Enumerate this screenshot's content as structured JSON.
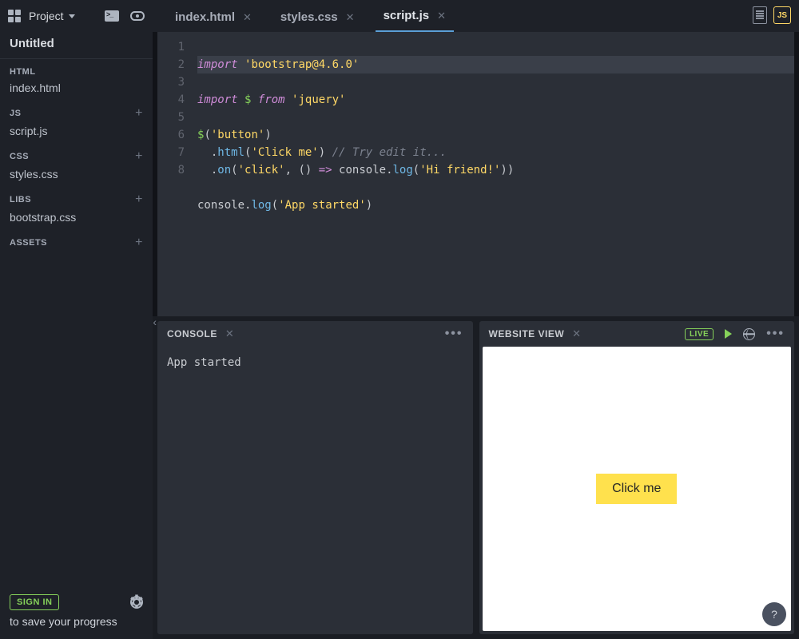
{
  "topbar": {
    "project_label": "Project"
  },
  "project": {
    "title": "Untitled"
  },
  "sections": {
    "html": {
      "heading": "HTML",
      "file": "index.html"
    },
    "js": {
      "heading": "JS",
      "file": "script.js"
    },
    "css": {
      "heading": "CSS",
      "file": "styles.css"
    },
    "libs": {
      "heading": "LIBS",
      "file": "bootstrap.css"
    },
    "assets": {
      "heading": "ASSETS"
    }
  },
  "signin": {
    "button": "SIGN IN",
    "caption": "to save your progress"
  },
  "tabs": {
    "t0": {
      "label": "index.html"
    },
    "t1": {
      "label": "styles.css"
    },
    "t2": {
      "label": "script.js"
    },
    "ext_badge": "JS"
  },
  "code": {
    "line1": {
      "kw": "import",
      "str": "'bootstrap@4.6.0'"
    },
    "line2": {
      "kw": "import",
      "var": "$",
      "from": "from",
      "str": "'jquery'"
    },
    "line4": {
      "dollar": "$",
      "op": "(",
      "str": "'button'",
      "cp": ")"
    },
    "line5": {
      "dot": ".",
      "m": "html",
      "op": "(",
      "str": "'Click me'",
      "cp": ")",
      "comment": "// Try edit it..."
    },
    "line6": {
      "dot": ".",
      "m": "on",
      "op": "(",
      "str": "'click'",
      "comma": ", ",
      "paren": "()",
      "arrow": " => ",
      "obj": "console",
      "d2": ".",
      "m2": "log",
      "op2": "(",
      "str2": "'Hi friend!'",
      "cp2": "))"
    },
    "line8": {
      "obj": "console",
      "dot": ".",
      "m": "log",
      "op": "(",
      "str": "'App started'",
      "cp": ")"
    }
  },
  "console": {
    "title": "CONSOLE",
    "output": "App started"
  },
  "website": {
    "title": "WEBSITE VIEW",
    "live": "LIVE",
    "button": "Click me"
  },
  "help": {
    "label": "?"
  }
}
